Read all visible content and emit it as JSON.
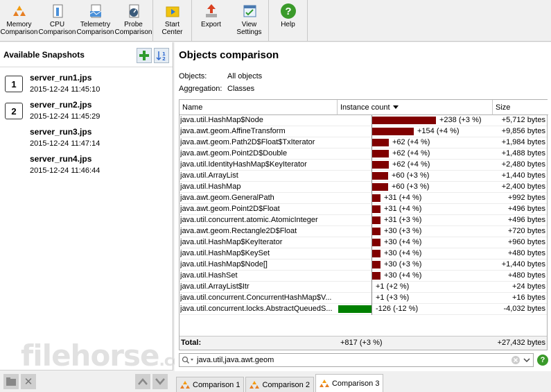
{
  "toolbar": {
    "buttons": [
      {
        "label": "Memory\nComparison",
        "icon": "memory-comparison-icon"
      },
      {
        "label": "CPU\nComparison",
        "icon": "cpu-comparison-icon"
      },
      {
        "label": "Telemetry\nComparison",
        "icon": "telemetry-comparison-icon"
      },
      {
        "label": "Probe\nComparison",
        "icon": "probe-comparison-icon"
      },
      {
        "label": "Start\nCenter",
        "icon": "start-center-icon"
      },
      {
        "label": "Export",
        "icon": "export-icon"
      },
      {
        "label": "View\nSettings",
        "icon": "view-settings-icon"
      },
      {
        "label": "Help",
        "icon": "help-icon"
      }
    ]
  },
  "sidebar": {
    "title": "Available Snapshots",
    "snapshots": [
      {
        "badge": "1",
        "name": "server_run1.jps",
        "date": "2015-12-24 11:45:10"
      },
      {
        "badge": "2",
        "name": "server_run2.jps",
        "date": "2015-12-24 11:45:29"
      },
      {
        "badge": "",
        "name": "server_run3.jps",
        "date": "2015-12-24 11:47:14"
      },
      {
        "badge": "",
        "name": "server_run4.jps",
        "date": "2015-12-24 11:46:44"
      }
    ]
  },
  "main": {
    "title": "Objects comparison",
    "objects_label": "Objects:",
    "objects_value": "All objects",
    "aggregation_label": "Aggregation:",
    "aggregation_value": "Classes",
    "columns": {
      "name": "Name",
      "count": "Instance count",
      "size": "Size"
    },
    "rows": [
      {
        "name": "java.util.HashMap$Node",
        "delta": 238,
        "count": "+238 (+3 %)",
        "size": "+5,712 bytes"
      },
      {
        "name": "java.awt.geom.AffineTransform",
        "delta": 154,
        "count": "+154 (+4 %)",
        "size": "+9,856 bytes"
      },
      {
        "name": "java.awt.geom.Path2D$Float$TxIterator",
        "delta": 62,
        "count": "+62 (+4 %)",
        "size": "+1,984 bytes"
      },
      {
        "name": "java.awt.geom.Point2D$Double",
        "delta": 62,
        "count": "+62 (+4 %)",
        "size": "+1,488 bytes"
      },
      {
        "name": "java.util.IdentityHashMap$KeyIterator",
        "delta": 62,
        "count": "+62 (+4 %)",
        "size": "+2,480 bytes"
      },
      {
        "name": "java.util.ArrayList",
        "delta": 60,
        "count": "+60 (+3 %)",
        "size": "+1,440 bytes"
      },
      {
        "name": "java.util.HashMap",
        "delta": 60,
        "count": "+60 (+3 %)",
        "size": "+2,400 bytes"
      },
      {
        "name": "java.awt.geom.GeneralPath",
        "delta": 31,
        "count": "+31 (+4 %)",
        "size": "+992 bytes"
      },
      {
        "name": "java.awt.geom.Point2D$Float",
        "delta": 31,
        "count": "+31 (+4 %)",
        "size": "+496 bytes"
      },
      {
        "name": "java.util.concurrent.atomic.AtomicInteger",
        "delta": 31,
        "count": "+31 (+3 %)",
        "size": "+496 bytes"
      },
      {
        "name": "java.awt.geom.Rectangle2D$Float",
        "delta": 30,
        "count": "+30 (+3 %)",
        "size": "+720 bytes"
      },
      {
        "name": "java.util.HashMap$KeyIterator",
        "delta": 30,
        "count": "+30 (+4 %)",
        "size": "+960 bytes"
      },
      {
        "name": "java.util.HashMap$KeySet",
        "delta": 30,
        "count": "+30 (+4 %)",
        "size": "+480 bytes"
      },
      {
        "name": "java.util.HashMap$Node[]",
        "delta": 30,
        "count": "+30 (+3 %)",
        "size": "+1,440 bytes"
      },
      {
        "name": "java.util.HashSet",
        "delta": 30,
        "count": "+30 (+4 %)",
        "size": "+480 bytes"
      },
      {
        "name": "java.util.ArrayList$Itr",
        "delta": 1,
        "count": "+1 (+2 %)",
        "size": "+24 bytes"
      },
      {
        "name": "java.util.concurrent.ConcurrentHashMap$V...",
        "delta": 1,
        "count": "+1 (+3 %)",
        "size": "+16 bytes"
      },
      {
        "name": "java.util.concurrent.locks.AbstractQueuedS...",
        "delta": -126,
        "count": "-126 (-12 %)",
        "size": "-4,032 bytes"
      }
    ],
    "total_label": "Total:",
    "total_count": "+817 (+3 %)",
    "total_size": "+27,432 bytes",
    "filter_value": "java.util,java.awt.geom",
    "tabs": [
      "Comparison 1",
      "Comparison 2",
      "Comparison 3"
    ],
    "active_tab": "Comparison 3"
  },
  "colors": {
    "positive_bar": "#800000",
    "negative_bar": "#008000",
    "help_green": "#3a9a2a"
  },
  "watermark": {
    "main": "filehorse",
    "suffix": ".com"
  }
}
